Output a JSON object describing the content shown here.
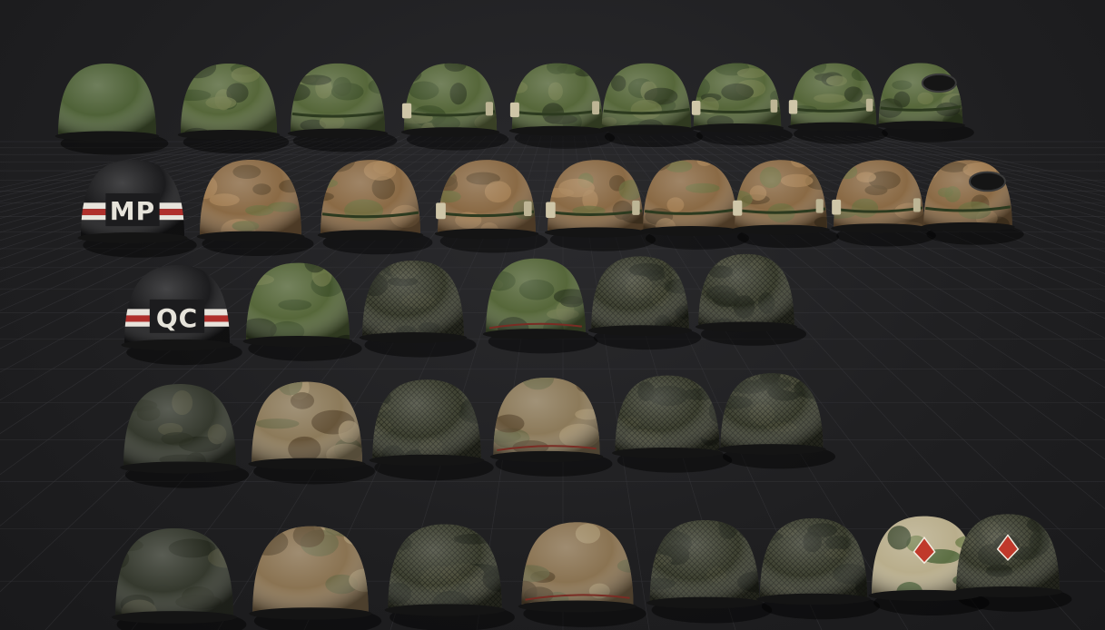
{
  "scene": {
    "background": "#1f1f21",
    "grid_color": "#3a3a3e",
    "colors": {
      "olive": "#4f6238",
      "olive_camo": "#56673a",
      "brown_camo": "#8a6a45",
      "dark_net": "#3f4232",
      "dark_blotch": "#35392e",
      "tan_camo": "#8c7a5a",
      "black": "#1c1c1e",
      "stripe_red": "#b0302c",
      "stripe_white": "#e8e4dc"
    }
  },
  "labels": {
    "mp": "MP",
    "qc": "QC"
  },
  "helmet_rows": [
    {
      "name": "row-1",
      "items": [
        {
          "variant": "olive-plain"
        },
        {
          "variant": "olive-camo-cover"
        },
        {
          "variant": "olive-camo-band"
        },
        {
          "variant": "olive-camo-band-items"
        },
        {
          "variant": "olive-camo-band-items"
        },
        {
          "variant": "olive-camo-band"
        },
        {
          "variant": "olive-camo-band-items"
        },
        {
          "variant": "olive-camo-band-items"
        },
        {
          "variant": "olive-camo-goggles"
        }
      ]
    },
    {
      "name": "row-2",
      "items": [
        {
          "variant": "black-mp"
        },
        {
          "variant": "brown-camo-cover"
        },
        {
          "variant": "brown-camo-band"
        },
        {
          "variant": "brown-camo-band-items"
        },
        {
          "variant": "brown-camo-band-items"
        },
        {
          "variant": "brown-camo-band"
        },
        {
          "variant": "brown-camo-band-items"
        },
        {
          "variant": "brown-camo-band-items"
        },
        {
          "variant": "brown-camo-goggles"
        }
      ]
    },
    {
      "name": "row-3",
      "items": [
        {
          "variant": "black-qc"
        },
        {
          "variant": "olive-camo-cover"
        },
        {
          "variant": "dark-net"
        },
        {
          "variant": "olive-camo-strap"
        },
        {
          "variant": "dark-net"
        },
        {
          "variant": "dark-net"
        }
      ]
    },
    {
      "name": "row-4",
      "items": [
        {
          "variant": "dark-blotch"
        },
        {
          "variant": "tan-camo-cover"
        },
        {
          "variant": "dark-net"
        },
        {
          "variant": "tan-camo-strap"
        },
        {
          "variant": "dark-net"
        },
        {
          "variant": "dark-net"
        }
      ]
    },
    {
      "name": "row-5",
      "items": [
        {
          "variant": "dark-blotch"
        },
        {
          "variant": "tan-brown-cover"
        },
        {
          "variant": "dark-net"
        },
        {
          "variant": "tan-brown-strap"
        },
        {
          "variant": "dark-net"
        },
        {
          "variant": "dark-net"
        },
        {
          "variant": "painted-insignia"
        },
        {
          "variant": "dark-net-insignia"
        }
      ]
    }
  ]
}
